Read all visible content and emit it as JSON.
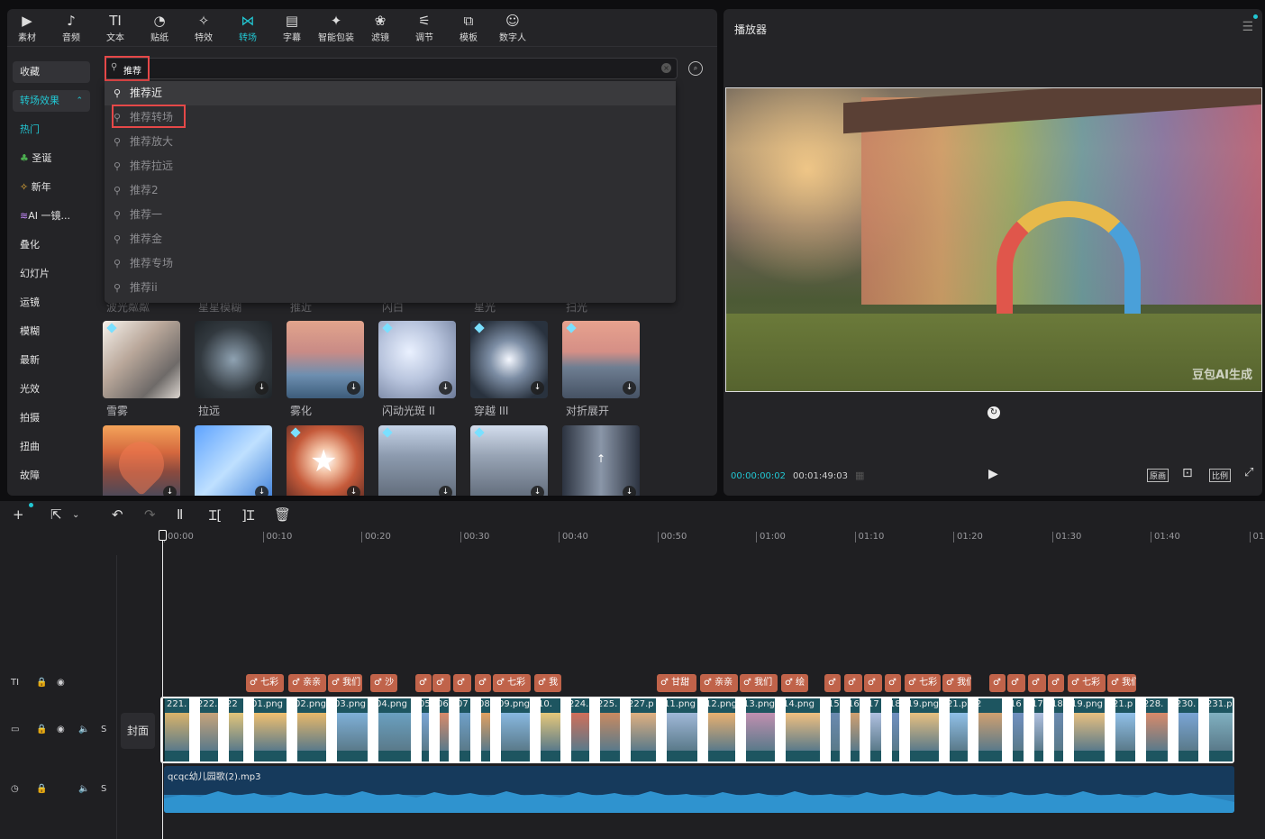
{
  "toolbar": {
    "items": [
      {
        "label": "素材",
        "icon": "▶"
      },
      {
        "label": "音频",
        "icon": "♪"
      },
      {
        "label": "文本",
        "icon": "TI"
      },
      {
        "label": "贴纸",
        "icon": "◔"
      },
      {
        "label": "特效",
        "icon": "✧"
      },
      {
        "label": "转场",
        "icon": "⋈"
      },
      {
        "label": "字幕",
        "icon": "▤"
      },
      {
        "label": "智能包装",
        "icon": "✦"
      },
      {
        "label": "滤镜",
        "icon": "❀"
      },
      {
        "label": "调节",
        "icon": "⚟"
      },
      {
        "label": "模板",
        "icon": "⧉"
      },
      {
        "label": "数字人",
        "icon": "☺"
      }
    ]
  },
  "sidebar": {
    "favorites": "收藏",
    "section": "转场效果",
    "items": [
      "热门",
      "圣诞",
      "新年",
      "AI 一镜...",
      "叠化",
      "幻灯片",
      "运镜",
      "模糊",
      "最新",
      "光效",
      "拍摄",
      "扭曲",
      "故障"
    ]
  },
  "search": {
    "value": "推荐",
    "suggestions": [
      "推荐近",
      "推荐转场",
      "推荐放大",
      "推荐拉远",
      "推荐2",
      "推荐一",
      "推荐金",
      "推荐专场",
      "推荐ii"
    ]
  },
  "grid": {
    "partial_row": [
      "波光粼粼",
      "星星模糊",
      "推近",
      "闪白",
      "星光",
      "扫光"
    ],
    "row1": [
      "雪雾",
      "拉远",
      "雾化",
      "闪动光斑 II",
      "穿越 III",
      "对折展开"
    ]
  },
  "player": {
    "title": "播放器",
    "watermark": "豆包AI生成",
    "current_time": "00:00:00:02",
    "total_time": "00:01:49:03",
    "btn_original": "原画",
    "btn_ratio": "比例"
  },
  "timeline": {
    "ruler": [
      "00:00",
      "00:10",
      "00:20",
      "00:30",
      "00:40",
      "00:50",
      "01:00",
      "01:10",
      "01:20",
      "01:30",
      "01:40",
      "01:5"
    ],
    "cover_label": "封面",
    "audio_name": "qcqc幼儿园歌(2).mp3",
    "stickers": [
      "七彩",
      "亲亲",
      "我们",
      "沙",
      "",
      "",
      "",
      "",
      "七彩",
      "我",
      "甘甜",
      "亲亲",
      "我们",
      "绘",
      "",
      "",
      "",
      "",
      "七彩",
      "我们",
      "",
      "",
      "",
      "",
      "七彩",
      "我们"
    ],
    "clips": [
      "221.",
      "222.",
      "22",
      "01.png",
      "02.png",
      "03.png",
      "04.png",
      "05",
      "06",
      "07",
      "08",
      "09.png",
      "10.",
      "224.",
      "225.",
      "227.p",
      "11.png",
      "12.png",
      "13.png",
      "14.png",
      "15",
      "16",
      "17",
      "18",
      "19.png",
      "21.p",
      "2",
      "16",
      "17",
      "18",
      "19.png",
      "21.p",
      "228.",
      "230.",
      "231.p"
    ]
  },
  "colors": {
    "accent": "#22c7d3",
    "highlight_red": "#e54848",
    "clip_teal": "#1d5560",
    "sticker": "#c0634a",
    "audio": "#1f6fa3"
  }
}
